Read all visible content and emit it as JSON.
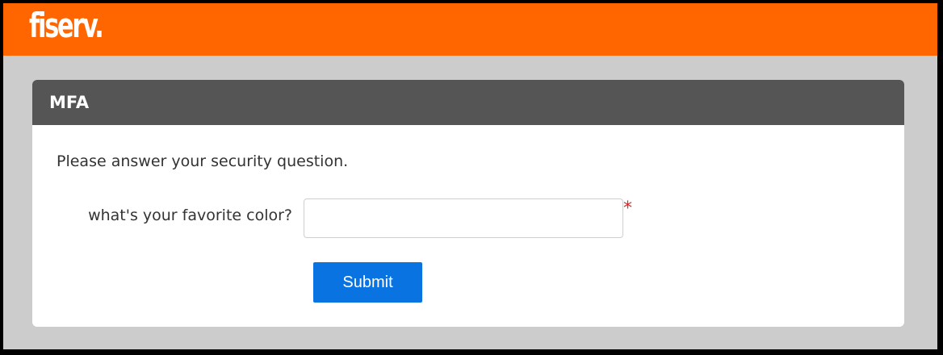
{
  "header": {
    "logo_text": "fiserv.",
    "brand_color": "#ff6600"
  },
  "card": {
    "title": "MFA",
    "instructions": "Please answer your security question.",
    "question": {
      "label": "what's your favorite color?",
      "value": "",
      "required_marker": "*"
    },
    "submit_label": "Submit",
    "submit_color": "#0a73e2"
  }
}
